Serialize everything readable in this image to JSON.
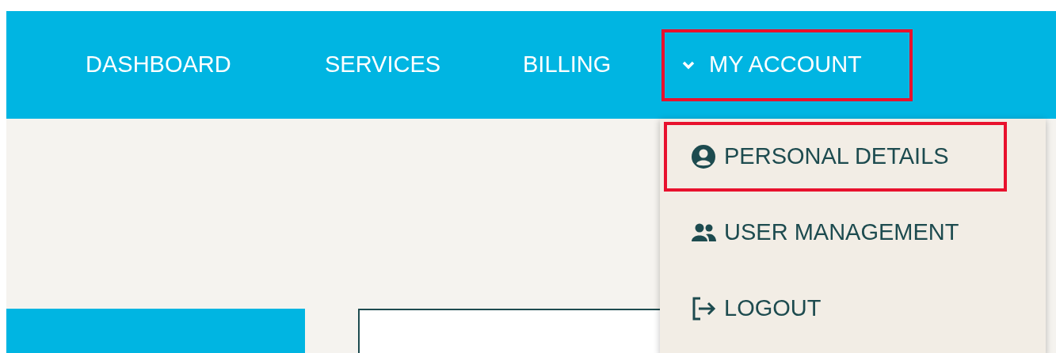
{
  "nav": {
    "items": [
      {
        "label": "DASHBOARD",
        "highlighted": false
      },
      {
        "label": "SERVICES",
        "highlighted": false
      },
      {
        "label": "BILLING",
        "highlighted": false
      },
      {
        "label": "MY ACCOUNT",
        "highlighted": true,
        "expanded": true
      }
    ]
  },
  "account_menu": {
    "items": [
      {
        "label": "PERSONAL DETAILS",
        "kind": "person",
        "highlighted": true
      },
      {
        "label": "USER MANAGEMENT",
        "kind": "users",
        "highlighted": false
      },
      {
        "label": "LOGOUT",
        "kind": "logout",
        "highlighted": false
      }
    ]
  }
}
